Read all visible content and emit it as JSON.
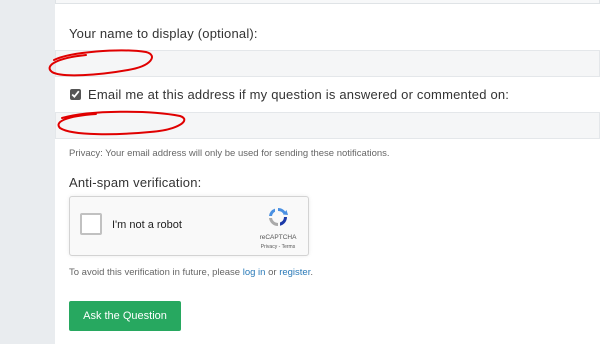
{
  "form": {
    "name_label": "Your name to display (optional):",
    "name_value": "",
    "email_notify_label": "Email me at this address if my question is answered or commented on:",
    "email_notify_checked": true,
    "email_value": "",
    "privacy_note": "Privacy: Your email address will only be used for sending these notifications.",
    "antispam_label": "Anti-spam verification:",
    "avoid_prefix": "To avoid this verification in future, please",
    "login_link": "log in",
    "or_text": "or",
    "register_link": "register",
    "period": ".",
    "submit_label": "Ask the Question"
  },
  "recaptcha": {
    "checkbox_label": "I'm not a robot",
    "brand": "reCAPTCHA",
    "privacy_link": "Privacy",
    "separator": "-",
    "terms_link": "Terms"
  },
  "colors": {
    "submit_bg": "#27a860",
    "link": "#2a7ab8",
    "scribble": "#e00000"
  }
}
